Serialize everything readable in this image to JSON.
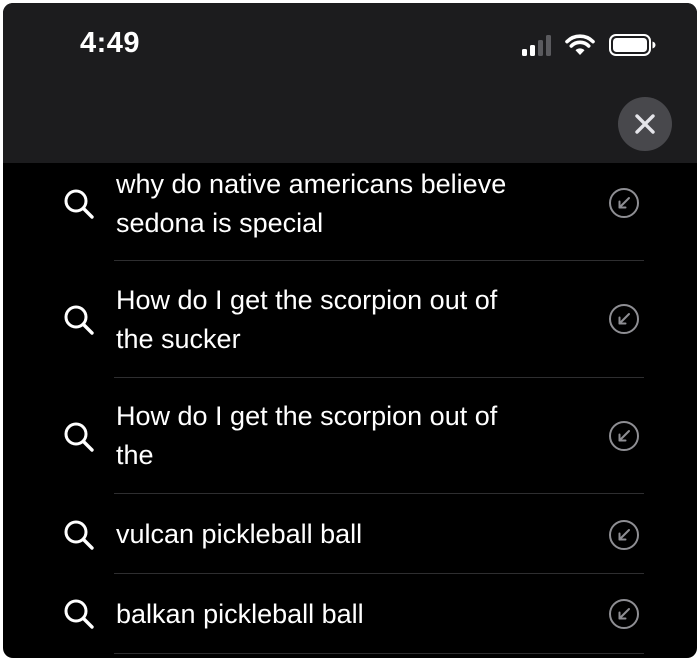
{
  "status_bar": {
    "time": "4:49",
    "icons": [
      "cellular-signal-icon",
      "wifi-icon",
      "battery-icon"
    ]
  },
  "close_button": {
    "icon": "close-icon"
  },
  "suggestions": [
    {
      "line1": "why do native americans believe",
      "line2": "sedona is special",
      "icon": "search-icon",
      "action_icon": "fill-arrow-icon"
    },
    {
      "line1": "How do I get the scorpion out of",
      "line2": "the sucker",
      "icon": "search-icon",
      "action_icon": "fill-arrow-icon"
    },
    {
      "line1": "How do I get the scorpion out of",
      "line2": "the",
      "icon": "search-icon",
      "action_icon": "fill-arrow-icon"
    },
    {
      "line1": "vulcan pickleball ball",
      "icon": "search-icon",
      "action_icon": "fill-arrow-icon"
    },
    {
      "line1": "balkan pickleball ball",
      "icon": "search-icon",
      "action_icon": "fill-arrow-icon"
    }
  ],
  "colors": {
    "background": "#000000",
    "top_area": "#1c1c1e",
    "text": "#ffffff",
    "close_button_bg": "#48484c",
    "divider": "#2e2e30",
    "fill_icon": "#8e8e93"
  }
}
